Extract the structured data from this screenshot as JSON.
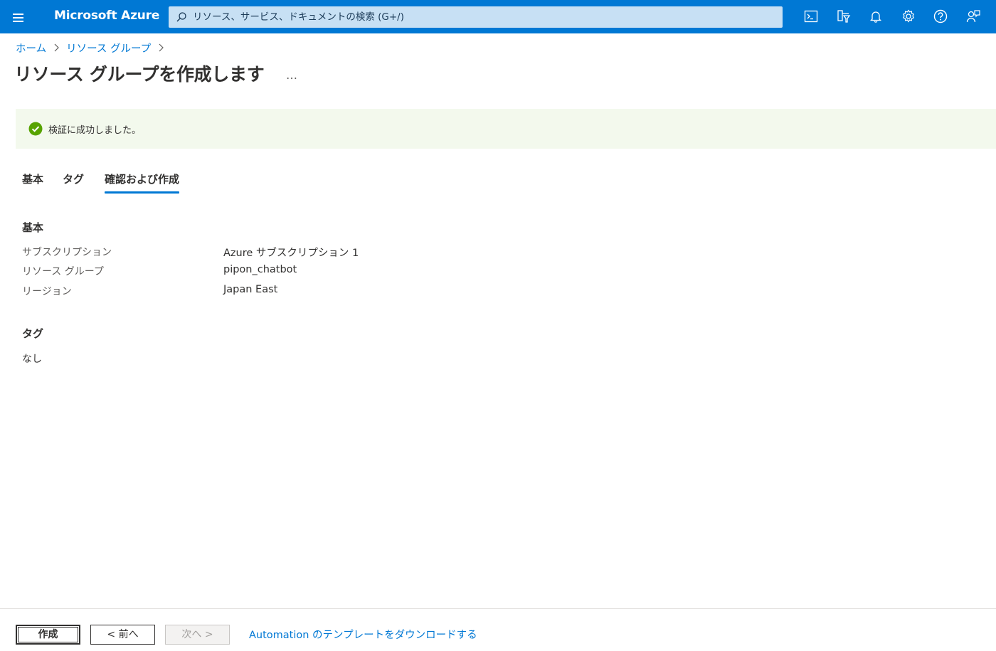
{
  "header": {
    "brand": "Microsoft Azure",
    "search_placeholder": "リソース、サービス、ドキュメントの検索 (G+/)",
    "icons": [
      "cloud-shell-icon",
      "directory-filter-icon",
      "notifications-icon",
      "settings-icon",
      "help-icon",
      "feedback-icon"
    ],
    "accent_color": "#0078d4"
  },
  "breadcrumb": {
    "items": [
      "ホーム",
      "リソース グループ"
    ]
  },
  "page": {
    "title": "リソース グループを作成します",
    "more": "…"
  },
  "banner": {
    "message": "検証に成功しました。",
    "status_color": "#57a300"
  },
  "tabs": [
    {
      "label": "基本"
    },
    {
      "label": "タグ"
    },
    {
      "label": "確認および作成",
      "active": true
    }
  ],
  "review": {
    "basics_title": "基本",
    "rows": [
      {
        "label": "サブスクリプション",
        "value": "Azure サブスクリプション 1"
      },
      {
        "label": "リソース グループ",
        "value": "pipon_chatbot"
      },
      {
        "label": "リージョン",
        "value": "Japan East"
      }
    ],
    "tags_title": "タグ",
    "tags_value": "なし"
  },
  "footer": {
    "create_label": "作成",
    "prev_label": "< 前へ",
    "next_label": "次へ >",
    "download_link": "Automation のテンプレートをダウンロードする"
  }
}
